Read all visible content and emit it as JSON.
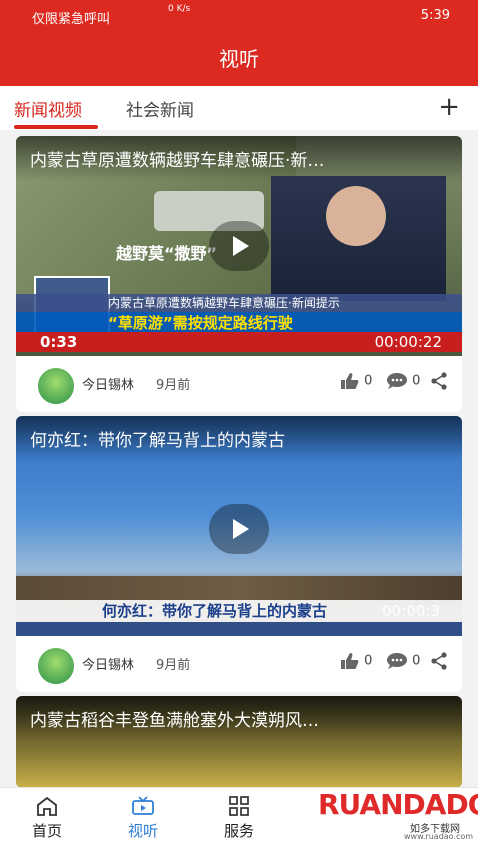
{
  "status_bar": {
    "left": "仅限紧急呼叫",
    "right": "5:39",
    "speed": "0 K/s"
  },
  "header": {
    "title": "视听"
  },
  "tabs": [
    {
      "label": "新闻视频"
    },
    {
      "label": "社会新闻"
    }
  ],
  "cards": [
    {
      "title": "内蒙古草原遭数辆越野车肆意碾压·新…",
      "overlay_top": "越野莫“撒野”",
      "caption1": "内蒙古草原遭数辆越野车肆意碾压·新闻提示",
      "caption2": "“草原游”需按规定路线行驶",
      "time_left": "0:33",
      "time_right": "00:00:22",
      "source": "今日锡林",
      "time": "9月前",
      "likes": "0",
      "comments": "0"
    },
    {
      "title": "何亦红：带你了解马背上的内蒙古",
      "caption1": "何亦红：带你了解马背上的内蒙古",
      "time_right": "00:00:3",
      "source": "今日锡林",
      "time": "9月前",
      "likes": "0",
      "comments": "0"
    },
    {
      "title": "内蒙古稻谷丰登鱼满舱塞外大漠朔风…"
    }
  ],
  "nav": [
    {
      "label": "首页"
    },
    {
      "label": "视听"
    },
    {
      "label": "服务"
    }
  ],
  "watermark": {
    "brand": "RUANDADO",
    "sub": "如多下载网",
    "url": "www.ruadao.com"
  },
  "colors": {
    "primary": "#dd2a20",
    "nav_active": "#2f7fd6"
  }
}
